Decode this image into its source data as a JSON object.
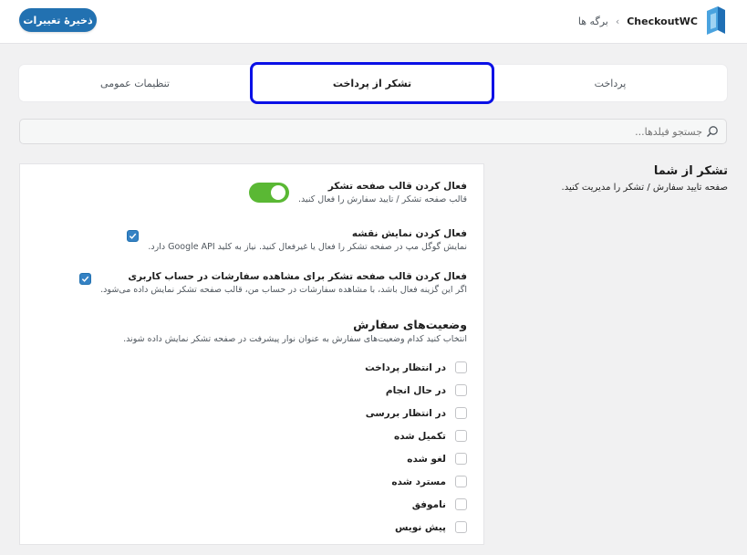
{
  "header": {
    "save_label": "ذخیرهٔ تغییرات",
    "breadcrumb": "برگه ها",
    "brand": "CheckoutWC"
  },
  "tabs": [
    {
      "label": "پرداخت",
      "active": false
    },
    {
      "label": "تشکر از پرداخت",
      "active": true
    },
    {
      "label": "تنظیمات عمومی",
      "active": false
    }
  ],
  "search": {
    "placeholder": "جستجو فیلدها..."
  },
  "section": {
    "title": "تشکر از شما",
    "description": "صفحه تایید سفارش / تشکر را مدیریت کنید."
  },
  "options": [
    {
      "title": "فعال کردن قالب صفحه تشکر",
      "description": "قالب صفحه تشکر / تایید سفارش را فعال کنید.",
      "control": "toggle",
      "enabled": true
    },
    {
      "title": "فعال کردن نمایش نقشه",
      "description": "نمایش گوگل مپ در صفحه تشکر را فعال یا غیرفعال کنید. نیاز به کلید Google API دارد.",
      "control": "checkbox",
      "checked": true
    },
    {
      "title": "فعال کردن قالب صفحه تشکر برای مشاهده سفارشات در حساب کاربری",
      "description": "اگر این گزینه فعال باشد، با مشاهده سفارشات در حساب من، قالب صفحه تشکر نمایش داده می‌شود.",
      "control": "checkbox",
      "checked": true
    }
  ],
  "order_statuses": {
    "title": "وضعیت‌های سفارش",
    "description": "انتخاب کنید کدام وضعیت‌های سفارش به عنوان نوار پیشرفت در صفحه تشکر نمایش داده شوند.",
    "items": [
      {
        "label": "در انتظار پرداخت",
        "checked": false
      },
      {
        "label": "در حال انجام",
        "checked": false
      },
      {
        "label": "در انتظار بررسی",
        "checked": false
      },
      {
        "label": "تکمیل شده",
        "checked": false
      },
      {
        "label": "لغو شده",
        "checked": false
      },
      {
        "label": "مسترد شده",
        "checked": false
      },
      {
        "label": "ناموفق",
        "checked": false
      },
      {
        "label": "پیش نویس",
        "checked": false
      }
    ]
  },
  "colors": {
    "primary": "#2271b1",
    "toggle_on": "#5ab834",
    "active_tab_outline": "#0a10e6",
    "checkbox_on": "#3582c4"
  },
  "icons": {
    "search": "search-icon",
    "chevron": "chevron-left-icon",
    "logo": "checkoutwc-logo-icon",
    "check": "check-icon"
  }
}
